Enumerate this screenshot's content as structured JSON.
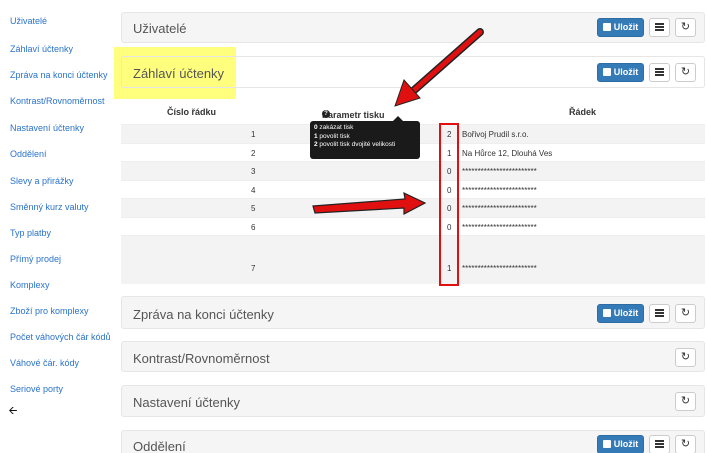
{
  "sidebar": {
    "items": [
      {
        "label": "Uživatelé"
      },
      {
        "label": "Záhlaví účtenky"
      },
      {
        "label": "Zpráva na konci účtenky"
      },
      {
        "label": "Kontrast/Rovnoměrnost"
      },
      {
        "label": "Nastavení účtenky"
      },
      {
        "label": "Oddělení"
      },
      {
        "label": "Slevy a přirážky"
      },
      {
        "label": "Směnný kurz valuty"
      },
      {
        "label": "Typ platby"
      },
      {
        "label": "Přímý prodej"
      },
      {
        "label": "Komplexy"
      },
      {
        "label": "Zboží pro komplexy"
      },
      {
        "label": "Počet váhových čár kódů"
      },
      {
        "label": "Váhové čár. kódy"
      },
      {
        "label": "Seriové porty"
      }
    ],
    "back_icon": "arrow-left-icon"
  },
  "panels": {
    "users": {
      "title": "Uživatelé"
    },
    "header": {
      "title": "Záhlaví účtenky"
    },
    "footer": {
      "title": "Zpráva na konci účtenky"
    },
    "contrast": {
      "title": "Kontrast/Rovnoměrnost"
    },
    "settings": {
      "title": "Nastavení účtenky"
    },
    "departments": {
      "title": "Oddělení"
    }
  },
  "buttons": {
    "save_label": "Uložit"
  },
  "table": {
    "headers": {
      "line_number": "Číslo řádku",
      "print_param": "Parametr tisku",
      "line": "Řádek"
    },
    "rows": [
      {
        "num": "1",
        "param": "2",
        "text": "Bořivoj Prudil s.r.o."
      },
      {
        "num": "2",
        "param": "1",
        "text": "Na Hůrce 12, Dlouhá Ves"
      },
      {
        "num": "3",
        "param": "0",
        "text": "************************"
      },
      {
        "num": "4",
        "param": "0",
        "text": "************************"
      },
      {
        "num": "5",
        "param": "0",
        "text": "************************"
      },
      {
        "num": "6",
        "param": "0",
        "text": "************************"
      },
      {
        "num": "7",
        "param": "1",
        "text": "************************"
      }
    ]
  },
  "tooltip": {
    "l0_key": "0",
    "l0_text": " zakázat tisk",
    "l1_key": "1",
    "l1_text": " povolit tisk",
    "l2_key": "2",
    "l2_text": " povolit tisk dvojité velikosti"
  },
  "colors": {
    "accent": "#337ab7",
    "annotation": "#e01010",
    "highlight": "#ffff66",
    "link": "#2a73c9"
  }
}
